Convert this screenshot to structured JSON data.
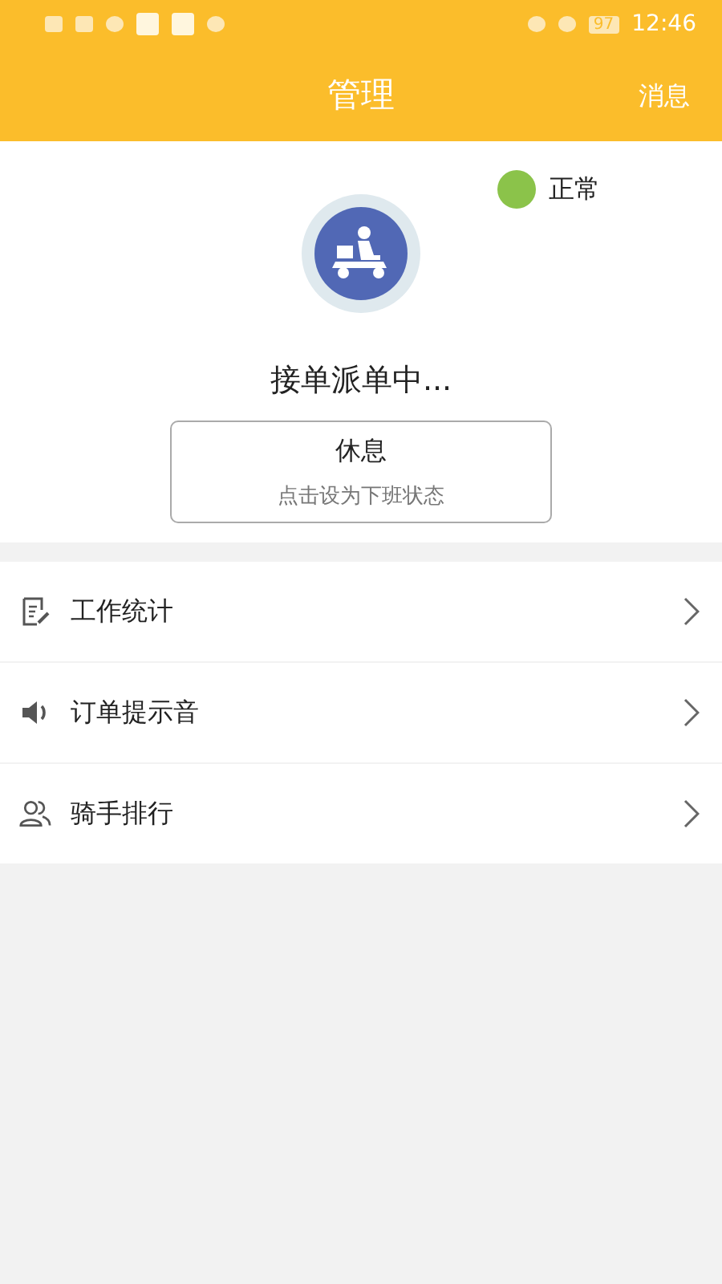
{
  "status_bar": {
    "battery": "97",
    "time": "12:46"
  },
  "header": {
    "title": "管理",
    "action": "消息"
  },
  "profile": {
    "status": {
      "label": "正常",
      "color": "#8bc34a"
    },
    "state_text": "接单派单中...",
    "toggle": {
      "label": "休息",
      "hint": "点击设为下班状态"
    }
  },
  "menu": [
    {
      "kind": "stats",
      "label": "工作统计"
    },
    {
      "kind": "sound",
      "label": "订单提示音"
    },
    {
      "kind": "riders",
      "label": "骑手排行"
    }
  ]
}
